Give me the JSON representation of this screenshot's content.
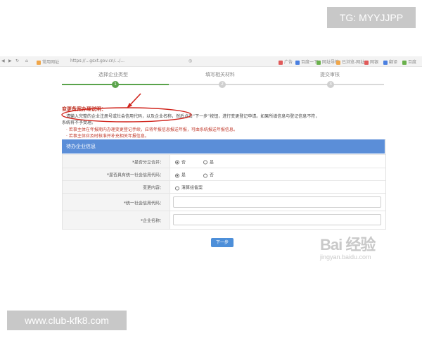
{
  "watermarks": {
    "top": "TG: MYYJJPP",
    "bottom": "www.club-kfk8.com"
  },
  "browser": {
    "url": "https://...gsxt.gov.cn/.../...",
    "bookmarks": [
      "常用网址",
      "广告",
      "百度一下",
      "网址导航",
      "已浏览-网址",
      "网银",
      "翻译",
      "百度"
    ]
  },
  "steps": [
    {
      "label": "选择企业类型",
      "number": "1"
    },
    {
      "label": "填写相关材料",
      "number": "2"
    },
    {
      "label": "提交审核",
      "number": "3"
    }
  ],
  "notice": {
    "title": "变更备案办理说明：",
    "line1": "请输入完整的企业注册号或社会信用代码，以及企业名称，然后点击“下一步”按钮，进行变更登记申请。如果所填信息与登记信息不符，",
    "line2": "系统将不予受理。",
    "red1": "· 若事主体在年报期内办理变更登记手续，应将年报信息报送年报，可由系统报送年报信息。",
    "red2": "· 若事主体应及时核准并补充相关年报信息。"
  },
  "form": {
    "header": "待办企业信息",
    "rows": [
      {
        "label": "*是否分立合并：",
        "options": [
          "否",
          "是"
        ],
        "selected": "否"
      },
      {
        "label": "*是否具有统一社会信用代码：",
        "options": [
          "是",
          "否"
        ],
        "selected": "是"
      },
      {
        "label": "变更内容：",
        "options": [
          "清算组备案"
        ],
        "selected": ""
      },
      {
        "label": "*统一社会信用代码：",
        "input": ""
      },
      {
        "label": "*企业名称：",
        "input": ""
      }
    ]
  },
  "buttons": {
    "next": "下一步"
  },
  "watermark_site": {
    "logo": "Bai 经验",
    "url": "jingyan.baidu.com"
  }
}
